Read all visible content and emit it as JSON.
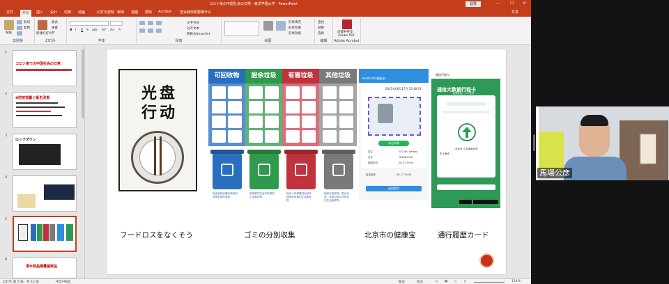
{
  "window": {
    "title": "コロナ後の中国社会の日常 · 東洋学園大学 · PowerPoint",
    "account_button": "登录"
  },
  "tabs": [
    "文件",
    "开始",
    "插入",
    "设计",
    "切换",
    "动画",
    "幻灯片放映",
    "审阅",
    "视图",
    "帮助",
    "Acrobat",
    "告诉我你想要做什么"
  ],
  "active_tab": "开始",
  "share_label": "共享",
  "ribbon": {
    "groups": [
      {
        "label": "剪贴板",
        "items": [
          "粘贴",
          "剪切",
          "复制",
          "格式刷"
        ]
      },
      {
        "label": "幻灯片",
        "items": [
          "新建幻灯片",
          "版式",
          "重置",
          "节"
        ]
      },
      {
        "label": "字体",
        "items": [
          "B",
          "I",
          "U",
          "S",
          "abc",
          "AV",
          "Aa",
          "A"
        ]
      },
      {
        "label": "段落",
        "items": [
          "文字方向",
          "对齐文本",
          "转换为SmartArt"
        ]
      },
      {
        "label": "绘图",
        "items": [
          "排列",
          "快速样式",
          "形状填充",
          "形状轮廓",
          "形状效果"
        ]
      },
      {
        "label": "编辑",
        "items": [
          "查找",
          "替换",
          "选择"
        ]
      },
      {
        "label": "Adobe Acrobat",
        "items": [
          "创建并共享",
          "Adobe PDF"
        ]
      }
    ]
  },
  "thumbnails": [
    {
      "num": "1",
      "title": "コロナ後での中国社会の日常"
    },
    {
      "num": "2",
      "title": "❶防疫措置と衛生改善"
    },
    {
      "num": "3",
      "title": "ロックダウン"
    },
    {
      "num": "4",
      "title": ""
    },
    {
      "num": "5",
      "title": ""
    },
    {
      "num": "6",
      "title": "清水鲜品碳量差鲜品"
    }
  ],
  "selected_thumbnail": "5",
  "slide": {
    "poster_chars": [
      "光",
      "盘",
      "行",
      "动"
    ],
    "garbage_headers": [
      "可回收物",
      "厨余垃圾",
      "有害垃圾",
      "其他垃圾"
    ],
    "garbage_colors": [
      "#2a6fbf",
      "#2f9a4d",
      "#c0323c",
      "#7a7a7a"
    ],
    "garbage_descriptions": [
      "指适宜回收循环使用和资源利用的废物",
      "指易腐烂的含有机质的生活废弃物",
      "指对人体健康或自然环境造成危害的生活废弃物",
      "指除可回收物、厨余垃圾、有害垃圾以外的其它生活废弃物"
    ],
    "phone1": {
      "header": "Health Kit(健康宝)",
      "time": "2021年06月17日 15:48:01",
      "status": "未见异常",
      "rows": [
        {
          "label": "姓名",
          "value": "ﾀﾝｸﾞﾀｶﾊｼ Kefaby"
        },
        {
          "label": "证件",
          "value": "TR6461240"
        },
        {
          "label": "核酸检测",
          "value": "06-17 15:00"
        },
        {
          "label": "疫苗接种",
          "value": "06-17 24:00"
        }
      ],
      "button": "返回首页"
    },
    "phone2": {
      "top": "通信行程卡",
      "heading": "通信大数据行程卡",
      "sub": "全国防疫，人人有责",
      "locations": "北京市,江苏省南京市",
      "city": "东上海市"
    },
    "captions": [
      "フードロスをなくそう",
      "ゴミの分別収集",
      "北京市の健康宝",
      "通行履歴カード"
    ]
  },
  "statusbar": {
    "slide_info": "幻灯片 第 5 张，共 12 张",
    "language": "中文(中国)",
    "notes": "备注",
    "comments": "批注",
    "zoom": "114%"
  },
  "participant": {
    "name": "馬場公彦"
  }
}
